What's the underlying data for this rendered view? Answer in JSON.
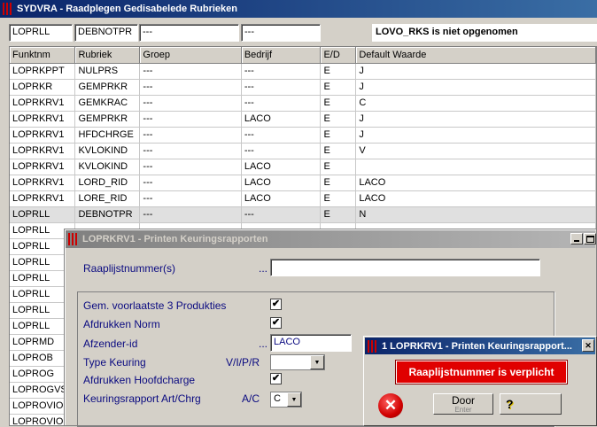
{
  "main": {
    "title": "SYDVRA - Raadplegen Gedisabelede Rubrieken",
    "filters": [
      "LOPRLL",
      "DEBNOTPR",
      "---",
      "---"
    ],
    "message": "LOVO_RKS is niet opgenomen",
    "columns": [
      "Funktnm",
      "Rubriek",
      "Groep",
      "Bedrijf",
      "E/D",
      "Default Waarde"
    ],
    "rows": [
      [
        "LOPRKPPT",
        "NULPRS",
        "---",
        "---",
        "E",
        "J"
      ],
      [
        "LOPRKR",
        "GEMPRKR",
        "---",
        "---",
        "E",
        "J"
      ],
      [
        "LOPRKRV1",
        "GEMKRAC",
        "---",
        "---",
        "E",
        "C"
      ],
      [
        "LOPRKRV1",
        "GEMPRKR",
        "---",
        "LACO",
        "E",
        "J"
      ],
      [
        "LOPRKRV1",
        "HFDCHRGE",
        "---",
        "---",
        "E",
        "J"
      ],
      [
        "LOPRKRV1",
        "KVLOKIND",
        "---",
        "---",
        "E",
        "V"
      ],
      [
        "LOPRKRV1",
        "KVLOKIND",
        "---",
        "LACO",
        "E",
        ""
      ],
      [
        "LOPRKRV1",
        "LORD_RID",
        "---",
        "LACO",
        "E",
        "LACO"
      ],
      [
        "LOPRKRV1",
        "LORE_RID",
        "---",
        "LACO",
        "E",
        "LACO"
      ],
      [
        "LOPRLL",
        "DEBNOTPR",
        "---",
        "---",
        "E",
        "N"
      ],
      [
        "LOPRLL",
        "",
        "",
        "",
        "",
        ""
      ],
      [
        "LOPRLL",
        "",
        "",
        "",
        "",
        ""
      ],
      [
        "LOPRLL",
        "",
        "",
        "",
        "",
        ""
      ],
      [
        "LOPRLL",
        "",
        "",
        "",
        "",
        ""
      ],
      [
        "LOPRLL",
        "",
        "",
        "",
        "",
        ""
      ],
      [
        "LOPRLL",
        "",
        "",
        "",
        "",
        ""
      ],
      [
        "LOPRLL",
        "",
        "",
        "",
        "",
        ""
      ],
      [
        "LOPRMD",
        "",
        "",
        "",
        "",
        ""
      ],
      [
        "LOPROB",
        "",
        "",
        "",
        "",
        ""
      ],
      [
        "LOPROG",
        "",
        "",
        "",
        "",
        ""
      ],
      [
        "LOPROGVS",
        "",
        "",
        "",
        "",
        ""
      ],
      [
        "LOPROVIO",
        "",
        "",
        "",
        "",
        ""
      ],
      [
        "LOPROVIO",
        "",
        "",
        "",
        "",
        ""
      ]
    ]
  },
  "dialog": {
    "title": "LOPRKRV1 - Printen Keuringsrapporten",
    "raaplijst_label": "Raaplijstnummer(s)",
    "dots": "...",
    "raaplijst_value": "",
    "options": {
      "gem_label": "Gem. voorlaatste 3 Produkties",
      "norm_label": "Afdrukken Norm",
      "afzender_label": "Afzender-id",
      "afzender_value": "LACO",
      "type_label": "Type Keuring",
      "type_hint": "V/I/P/R",
      "type_value": "",
      "hoofd_label": "Afdrukken Hoofdcharge",
      "art_label": "Keuringsrapport Art/Chrg",
      "art_hint": "A/C",
      "art_value": "C",
      "check": "✔"
    }
  },
  "alert": {
    "title": "1 LOPRKRV1 - Printen Keuringsrapport...",
    "message": "Raaplijstnummer is verplicht",
    "door_label": "Door",
    "door_sub": "Enter",
    "help_glyph": "?",
    "error_glyph": "✕",
    "close_glyph": "✕"
  },
  "colors": {
    "error_red": "#e00000",
    "label_blue": "#0a0a80"
  }
}
